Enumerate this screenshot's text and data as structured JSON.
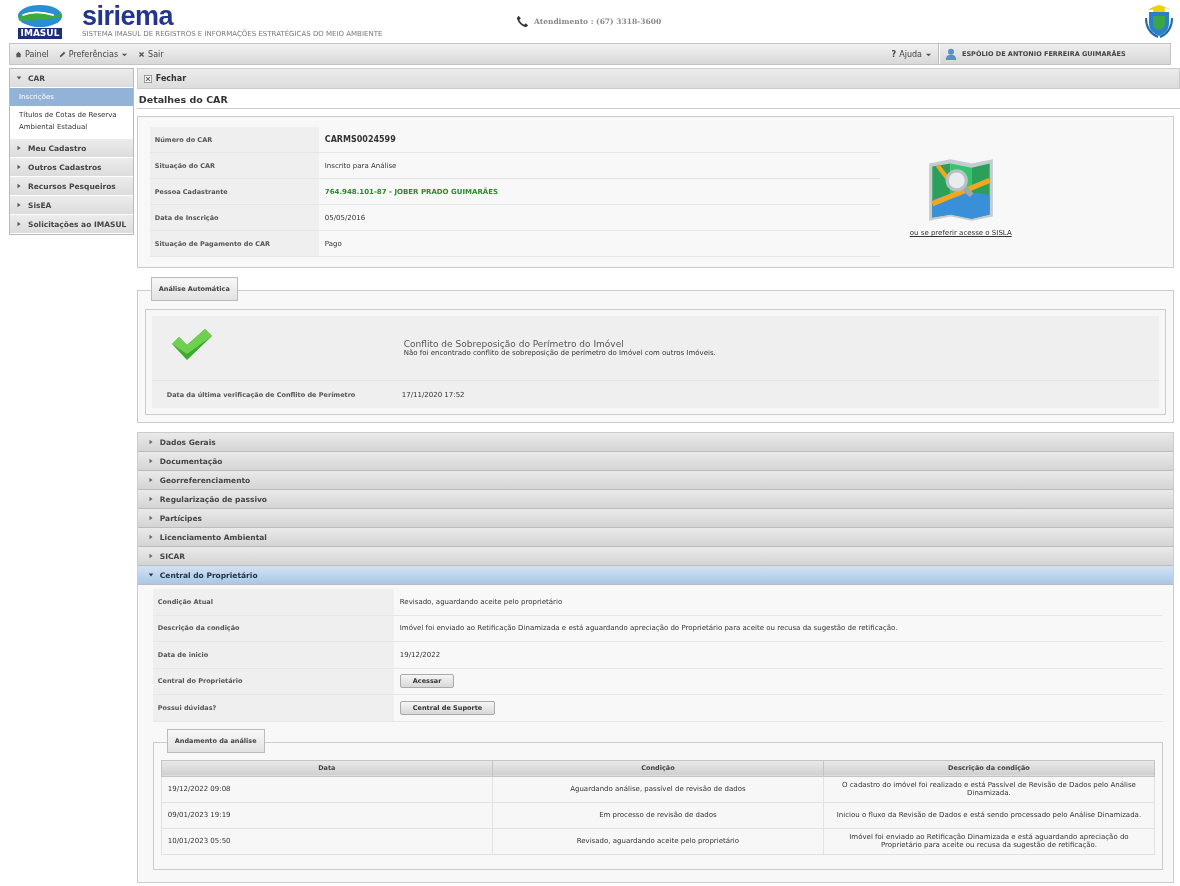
{
  "header": {
    "org": "IMASUL",
    "brand": "siriema",
    "subtitle": "SISTEMA IMASUL DE REGISTROS E INFORMAÇÕES ESTRATÉGICAS DO MEIO AMBIENTE",
    "contact": "Atendimento : (67) 3318-3600"
  },
  "menubar": {
    "left": [
      {
        "kind": "home",
        "label": "Painel",
        "dropdown": false
      },
      {
        "kind": "edit",
        "label": "Preferências",
        "dropdown": true
      },
      {
        "kind": "close",
        "label": "Sair",
        "dropdown": false
      }
    ],
    "help": {
      "icon": "?",
      "label": "Ajuda",
      "dropdown": true
    },
    "user": "ESPÓLIO DE ANTONIO FERREIRA GUIMARÃES"
  },
  "sidebar": [
    {
      "label": "CAR",
      "expanded": true,
      "children": [
        {
          "label": "Inscrições",
          "selected": true
        },
        {
          "label": "Títulos de Cotas de Reserva Ambiental Estadual",
          "selected": false
        }
      ]
    },
    {
      "label": "Meu Cadastro",
      "expanded": false
    },
    {
      "label": "Outros Cadastros",
      "expanded": false
    },
    {
      "label": "Recursos Pesqueiros",
      "expanded": false
    },
    {
      "label": "SisEA",
      "expanded": false
    },
    {
      "label": "Solicitações ao IMASUL",
      "expanded": false
    }
  ],
  "toolbar": {
    "close": "Fechar"
  },
  "page_title": "Detalhes do CAR",
  "details": [
    {
      "label": "Número do CAR",
      "value": "CARMS0024599",
      "kind": "strong"
    },
    {
      "label": "Situação do CAR",
      "value": "Inscrito para Análise",
      "kind": "plain"
    },
    {
      "label": "Pessoa Cadastrante",
      "value": "764.948.101-87 - JOBER PRADO GUIMARÃES",
      "kind": "highlight"
    },
    {
      "label": "Data de Inscrição",
      "value": "05/05/2016",
      "kind": "plain"
    },
    {
      "label": "Situação de Pagamento do CAR",
      "value": "Pago",
      "kind": "plain"
    }
  ],
  "sisla_link": "ou se preferir acesse o SISLA",
  "auto_analysis": {
    "legend": "Análise Automática",
    "title": "Conflito de Sobreposição do Perímetro do Imóvel",
    "message": "Não foi encontrado conflito de sobreposição de perímetro do Imóvel com outros Imóveis.",
    "date_label": "Data da última verificação de Conflito de Perímetro",
    "date": "17/11/2020 17:52"
  },
  "accordion": [
    {
      "label": "Dados Gerais",
      "expanded": false
    },
    {
      "label": "Documentação",
      "expanded": false
    },
    {
      "label": "Georreferenciamento",
      "expanded": false
    },
    {
      "label": "Regularização de passivo",
      "expanded": false
    },
    {
      "label": "Partícipes",
      "expanded": false
    },
    {
      "label": "Licenciamento Ambiental",
      "expanded": false
    },
    {
      "label": "SICAR",
      "expanded": false
    },
    {
      "label": "Central do Proprietário",
      "expanded": true
    }
  ],
  "owner_center": [
    {
      "label": "Condição Atual",
      "kind": "text",
      "value": "Revisado, aguardando aceite pelo proprietário"
    },
    {
      "label": "Descrição da condição",
      "kind": "text",
      "value": "Imóvel foi enviado ao Retificação Dinamizada e está aguardando apreciação do Proprietário para aceite ou recusa da sugestão de retificação."
    },
    {
      "label": "Data de inicio",
      "kind": "text",
      "value": "19/12/2022"
    },
    {
      "label": "Central do Proprietário",
      "kind": "button",
      "value": "Acessar"
    },
    {
      "label": "Possui dúvidas?",
      "kind": "button",
      "value": "Central de Suporte"
    }
  ],
  "progress": {
    "legend": "Andamento da análise",
    "columns": [
      "Data",
      "Condição",
      "Descrição da condição"
    ],
    "rows": [
      [
        "19/12/2022 09:08",
        "Aguardando análise, passível de revisão de dados",
        "O cadastro do imóvel foi realizado e está Passível de Revisão de Dados pelo Análise Dinamizada."
      ],
      [
        "09/01/2023 19:19",
        "Em processo de revisão de dados",
        "Iniciou o fluxo da Revisão de Dados e está sendo processado pelo Análise Dinamizada."
      ],
      [
        "10/01/2023 05:50",
        "Revisado, aguardando aceite pelo proprietário",
        "Imóvel foi enviado ao Retificação Dinamizada e está aguardando apreciação do Proprietário para aceite ou recusa da sugestão de retificação."
      ]
    ]
  }
}
